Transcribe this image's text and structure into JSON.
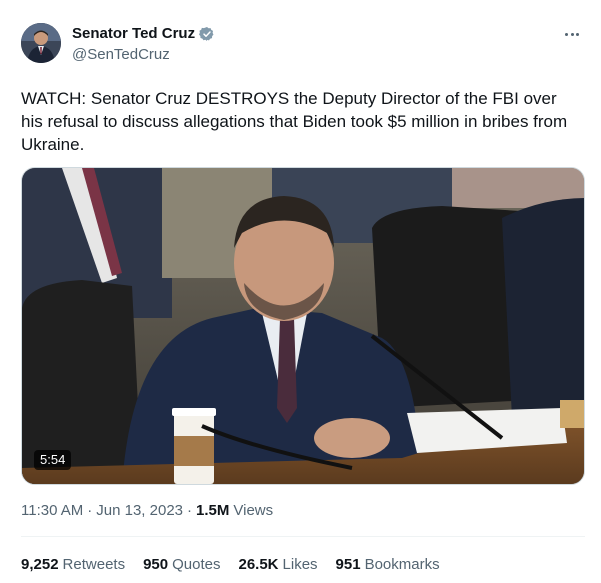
{
  "author": {
    "display_name": "Senator Ted Cruz",
    "handle": "@SenTedCruz",
    "verified_icon": "verified-badge-icon",
    "verified_color": "#829aab"
  },
  "tweet": {
    "text": "WATCH: Senator Cruz DESTROYS the Deputy Director of the FBI over his refusal to discuss allegations that Biden took $5 million in bribes from Ukraine."
  },
  "media": {
    "duration": "5:54"
  },
  "meta": {
    "time": "11:30 AM",
    "date": "Jun 13, 2023",
    "views_count": "1.5M",
    "views_label": "Views",
    "separator": "·"
  },
  "stats": {
    "retweets_count": "9,252",
    "retweets_label": "Retweets",
    "quotes_count": "950",
    "quotes_label": "Quotes",
    "likes_count": "26.5K",
    "likes_label": "Likes",
    "bookmarks_count": "951",
    "bookmarks_label": "Bookmarks"
  },
  "colors": {
    "text_primary": "#0f1419",
    "text_secondary": "#536471",
    "divider": "#eff3f4"
  }
}
